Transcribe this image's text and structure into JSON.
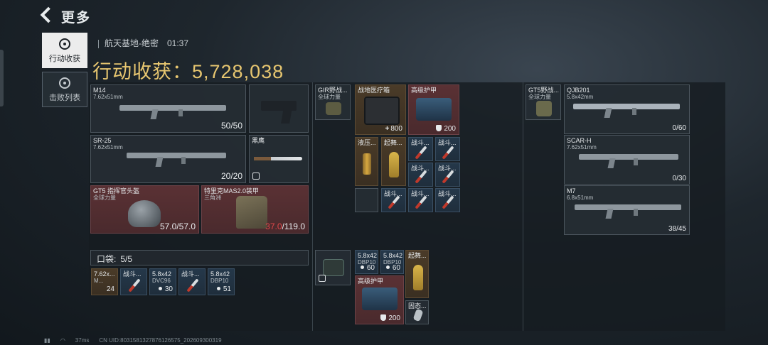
{
  "nav": {
    "back_label": "更多"
  },
  "tabs": [
    {
      "label": "行动收获",
      "active": true,
      "icon": "target-icon"
    },
    {
      "label": "击败列表",
      "active": false,
      "icon": "skull-icon"
    }
  ],
  "header": {
    "map": "航天基地-绝密",
    "time": "01:37",
    "harvest_label": "行动收获：",
    "harvest_value": "5,728,038"
  },
  "loadout": {
    "m14": {
      "name": "M14",
      "caliber": "7.62x51mm",
      "ammo": "50/50"
    },
    "sr25": {
      "name": "SR-25",
      "caliber": "7.62x51mm",
      "ammo": "20/20"
    },
    "knife": {
      "name": "黑鹰"
    },
    "helmet": {
      "name": "GT5 指挥官头盔",
      "sub": "全球力量",
      "durability": "57.0/57.0"
    },
    "armor": {
      "name": "特里克MAS2.0装甲",
      "sub": "三角洲",
      "durability_current": "37.0",
      "durability_max": "/119.0"
    },
    "pocket": {
      "label": "口袋:",
      "count": "5/5"
    },
    "pocket_items": [
      {
        "name": "7.62x...",
        "sub": "M...",
        "count": "24"
      },
      {
        "name": "战斗...",
        "count": ""
      },
      {
        "name": "5.8x42",
        "sub": "DVC96",
        "count": "30"
      },
      {
        "name": "战斗...",
        "count": ""
      },
      {
        "name": "5.8x42",
        "sub": "DBP10",
        "count": "51"
      }
    ]
  },
  "backpack": {
    "rig": {
      "name": "GIR野战...",
      "sub": "全球力量"
    },
    "medkit": {
      "name": "战地医疗箱",
      "count": "800"
    },
    "armor_plate": {
      "name": "高级护甲",
      "count": "200"
    },
    "hydraulic": {
      "name": "液压..."
    },
    "dancer": {
      "name": "起舞..."
    },
    "syringes": [
      "战斗...",
      "战斗...",
      "战斗...",
      "战斗...",
      "战斗...",
      "战斗...",
      "战斗...",
      "战斗..."
    ],
    "lower": {
      "case_count": "",
      "ammo1": {
        "name": "5.8x42",
        "sub": "DBP10",
        "count": "60"
      },
      "ammo2": {
        "name": "5.8x42",
        "sub": "DBP10",
        "count": "60"
      },
      "dancer2": {
        "name": "起舞..."
      },
      "armor2": {
        "name": "高级护甲",
        "count": "200"
      },
      "small": {
        "name": "固态..."
      }
    }
  },
  "safebox": {
    "rig": {
      "name": "GT5野战...",
      "sub": "全球力量"
    },
    "qjb": {
      "name": "QJB201",
      "caliber": "5.8x42mm",
      "ammo": "0/60"
    },
    "scar": {
      "name": "SCAR-H",
      "caliber": "7.62x51mm",
      "ammo": "0/30"
    },
    "m7": {
      "name": "M7",
      "caliber": "6.8x51mm",
      "ammo": "38/45"
    }
  },
  "footer": {
    "ping": "37ms",
    "uid": "CN UID:80315813278761265​75_202609300319"
  },
  "colors": {
    "gold": "#e7c670",
    "red_text": "#e0474a",
    "red_cell": "#5a3134"
  }
}
